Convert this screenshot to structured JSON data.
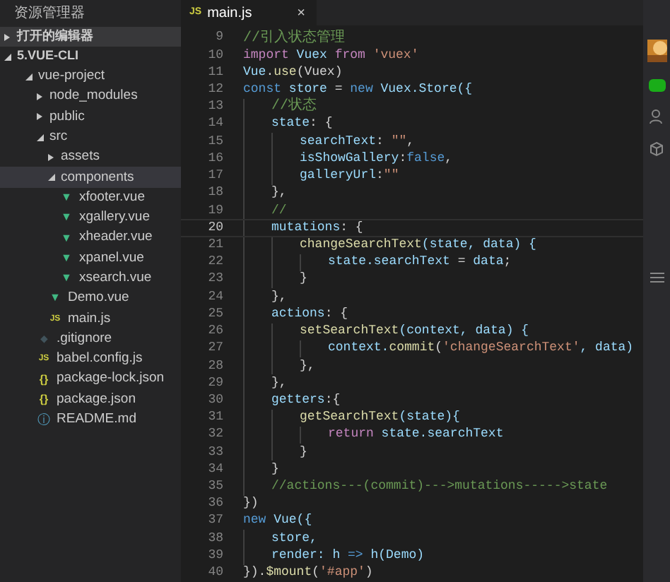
{
  "sidebar": {
    "title": "资源管理器",
    "sections": [
      {
        "label": "打开的编辑器",
        "expanded": false
      },
      {
        "label": "5.VUE-CLI",
        "expanded": true
      }
    ],
    "tree": [
      {
        "label": "vue-project",
        "kind": "folder",
        "expanded": true,
        "selected": false,
        "children": [
          {
            "label": "node_modules",
            "kind": "folder",
            "expanded": false,
            "selected": false
          },
          {
            "label": "public",
            "kind": "folder",
            "expanded": false,
            "selected": false
          },
          {
            "label": "src",
            "kind": "folder",
            "expanded": true,
            "selected": false,
            "children": [
              {
                "label": "assets",
                "kind": "folder",
                "expanded": false,
                "selected": false
              },
              {
                "label": "components",
                "kind": "folder",
                "expanded": true,
                "selected": true,
                "children": [
                  {
                    "label": "xfooter.vue",
                    "kind": "vue",
                    "icon": "▼",
                    "selected": false
                  },
                  {
                    "label": "xgallery.vue",
                    "kind": "vue",
                    "icon": "▼",
                    "selected": false
                  },
                  {
                    "label": "xheader.vue",
                    "kind": "vue",
                    "icon": "▼",
                    "selected": false
                  },
                  {
                    "label": "xpanel.vue",
                    "kind": "vue",
                    "icon": "▼",
                    "selected": false
                  },
                  {
                    "label": "xsearch.vue",
                    "kind": "vue",
                    "icon": "▼",
                    "selected": false
                  }
                ]
              },
              {
                "label": "Demo.vue",
                "kind": "vue",
                "icon": "▼",
                "selected": false
              },
              {
                "label": "main.js",
                "kind": "js",
                "icon": "JS",
                "selected": false
              }
            ]
          },
          {
            "label": ".gitignore",
            "kind": "git",
            "icon": "◆",
            "selected": false
          },
          {
            "label": "babel.config.js",
            "kind": "js",
            "icon": "JS",
            "selected": false
          },
          {
            "label": "package-lock.json",
            "kind": "json",
            "icon": "{}",
            "selected": false
          },
          {
            "label": "package.json",
            "kind": "json",
            "icon": "{}",
            "selected": false
          },
          {
            "label": "README.md",
            "kind": "info",
            "icon": "ⓘ",
            "selected": false
          }
        ]
      }
    ]
  },
  "tab": {
    "icon": "JS",
    "label": "main.js",
    "close": "×"
  },
  "code": [
    {
      "number": "9",
      "current": false,
      "tokens": [
        {
          "text": "//引入状态管理",
          "kind": "comment"
        }
      ]
    },
    {
      "number": "10",
      "current": false,
      "tokens": [
        {
          "text": "import",
          "kind": "control"
        },
        {
          "text": " Vuex ",
          "kind": "var"
        },
        {
          "text": "from",
          "kind": "control"
        },
        {
          "text": " 'vuex'",
          "kind": "string"
        }
      ]
    },
    {
      "number": "11",
      "current": false,
      "tokens": [
        {
          "text": "Vue",
          "kind": "var"
        },
        {
          "text": ".",
          "kind": "plain"
        },
        {
          "text": "use",
          "kind": "func"
        },
        {
          "text": "(Vuex)",
          "kind": "plain"
        }
      ]
    },
    {
      "number": "12",
      "current": false,
      "tokens": [
        {
          "text": "const",
          "kind": "keyword"
        },
        {
          "text": " store ",
          "kind": "var"
        },
        {
          "text": "= ",
          "kind": "plain"
        },
        {
          "text": "new",
          "kind": "keyword"
        },
        {
          "text": " Vuex.Store({",
          "kind": "var"
        }
      ],
      "children": [
        {
          "number": "13",
          "current": false,
          "tokens": [
            {
              "text": "//状态",
              "kind": "comment"
            }
          ]
        },
        {
          "number": "14",
          "current": false,
          "tokens": [
            {
              "text": "state",
              "kind": "var"
            },
            {
              "text": ": {",
              "kind": "plain"
            }
          ],
          "children": [
            {
              "number": "15",
              "current": false,
              "tokens": [
                {
                  "text": "searchText",
                  "kind": "var"
                },
                {
                  "text": ": ",
                  "kind": "plain"
                },
                {
                  "text": "\"\"",
                  "kind": "string"
                },
                {
                  "text": ",",
                  "kind": "plain"
                }
              ]
            },
            {
              "number": "16",
              "current": false,
              "tokens": [
                {
                  "text": "isShowGallery",
                  "kind": "var"
                },
                {
                  "text": ":",
                  "kind": "plain"
                },
                {
                  "text": "false",
                  "kind": "keyword"
                },
                {
                  "text": ",",
                  "kind": "plain"
                }
              ]
            },
            {
              "number": "17",
              "current": false,
              "tokens": [
                {
                  "text": "galleryUrl",
                  "kind": "var"
                },
                {
                  "text": ":",
                  "kind": "plain"
                },
                {
                  "text": "\"\"",
                  "kind": "string"
                }
              ]
            }
          ]
        },
        {
          "number": "18",
          "current": false,
          "tokens": [
            {
              "text": "},",
              "kind": "plain"
            }
          ]
        },
        {
          "number": "19",
          "current": false,
          "tokens": [
            {
              "text": "//",
              "kind": "comment"
            }
          ]
        },
        {
          "number": "20",
          "current": true,
          "tokens": [
            {
              "text": "mutations",
              "kind": "var"
            },
            {
              "text": ": {",
              "kind": "plain"
            }
          ],
          "children": [
            {
              "number": "21",
              "current": false,
              "tokens": [
                {
                  "text": "changeSearchText",
                  "kind": "func"
                },
                {
                  "text": "(state, data) {",
                  "kind": "var"
                }
              ],
              "children": [
                {
                  "number": "22",
                  "current": false,
                  "tokens": [
                    {
                      "text": "state.searchText ",
                      "kind": "var"
                    },
                    {
                      "text": "= ",
                      "kind": "plain"
                    },
                    {
                      "text": "data",
                      "kind": "var"
                    },
                    {
                      "text": ";",
                      "kind": "plain"
                    }
                  ]
                }
              ]
            },
            {
              "number": "23",
              "current": false,
              "tokens": [
                {
                  "text": "}",
                  "kind": "plain"
                }
              ]
            }
          ]
        },
        {
          "number": "24",
          "current": false,
          "tokens": [
            {
              "text": "},",
              "kind": "plain"
            }
          ]
        },
        {
          "number": "25",
          "current": false,
          "tokens": [
            {
              "text": "actions",
              "kind": "var"
            },
            {
              "text": ": {",
              "kind": "plain"
            }
          ],
          "children": [
            {
              "number": "26",
              "current": false,
              "tokens": [
                {
                  "text": "setSearchText",
                  "kind": "func"
                },
                {
                  "text": "(context, data) {",
                  "kind": "var"
                }
              ],
              "children": [
                {
                  "number": "27",
                  "current": false,
                  "tokens": [
                    {
                      "text": "context.",
                      "kind": "var"
                    },
                    {
                      "text": "commit",
                      "kind": "func"
                    },
                    {
                      "text": "(",
                      "kind": "plain"
                    },
                    {
                      "text": "'changeSearchText'",
                      "kind": "string"
                    },
                    {
                      "text": ", data)",
                      "kind": "var"
                    }
                  ]
                }
              ]
            },
            {
              "number": "28",
              "current": false,
              "tokens": [
                {
                  "text": "},",
                  "kind": "plain"
                }
              ]
            }
          ]
        },
        {
          "number": "29",
          "current": false,
          "tokens": [
            {
              "text": "},",
              "kind": "plain"
            }
          ]
        },
        {
          "number": "30",
          "current": false,
          "tokens": [
            {
              "text": "getters",
              "kind": "var"
            },
            {
              "text": ":{",
              "kind": "plain"
            }
          ],
          "children": [
            {
              "number": "31",
              "current": false,
              "tokens": [
                {
                  "text": "getSearchText",
                  "kind": "func"
                },
                {
                  "text": "(state){",
                  "kind": "var"
                }
              ],
              "children": [
                {
                  "number": "32",
                  "current": false,
                  "tokens": [
                    {
                      "text": "return",
                      "kind": "control"
                    },
                    {
                      "text": " state.searchText",
                      "kind": "var"
                    }
                  ]
                }
              ]
            },
            {
              "number": "33",
              "current": false,
              "tokens": [
                {
                  "text": "}",
                  "kind": "plain"
                }
              ]
            }
          ]
        },
        {
          "number": "34",
          "current": false,
          "tokens": [
            {
              "text": "}",
              "kind": "plain"
            }
          ]
        },
        {
          "number": "35",
          "current": false,
          "tokens": [
            {
              "text": "//actions---(commit)--->mutations----->state",
              "kind": "comment"
            }
          ]
        }
      ]
    },
    {
      "number": "36",
      "current": false,
      "tokens": [
        {
          "text": "})",
          "kind": "plain"
        }
      ]
    },
    {
      "number": "37",
      "current": false,
      "tokens": [
        {
          "text": "new",
          "kind": "keyword"
        },
        {
          "text": " Vue({",
          "kind": "var"
        }
      ],
      "children": [
        {
          "number": "38",
          "current": false,
          "tokens": [
            {
              "text": "store,",
              "kind": "var"
            }
          ]
        },
        {
          "number": "39",
          "current": false,
          "tokens": [
            {
              "text": "render",
              "kind": "var"
            },
            {
              "text": ": h ",
              "kind": "var"
            },
            {
              "text": "=>",
              "kind": "keyword"
            },
            {
              "text": " h(Demo)",
              "kind": "var"
            }
          ]
        }
      ]
    },
    {
      "number": "40",
      "current": false,
      "tokens": [
        {
          "text": "}).",
          "kind": "plain"
        },
        {
          "text": "$mount",
          "kind": "func"
        },
        {
          "text": "(",
          "kind": "plain"
        },
        {
          "text": "'#app'",
          "kind": "string"
        },
        {
          "text": ")",
          "kind": "plain"
        }
      ]
    }
  ]
}
